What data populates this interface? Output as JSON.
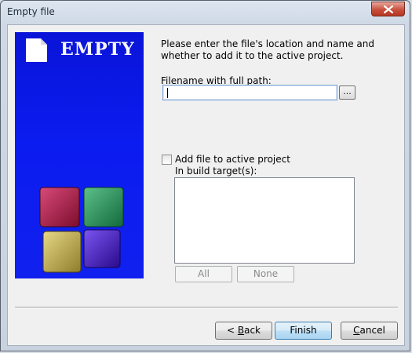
{
  "window": {
    "title": "Empty file",
    "close_icon": "close-x-icon"
  },
  "banner": {
    "text": "EMPTY",
    "icons": [
      "document-icon",
      "codeblocks-cubes-logo"
    ],
    "colors": {
      "background": "#0b1cf0",
      "cube_red": "#b0163e",
      "cube_green": "#1f8a52",
      "cube_yellow": "#c9b54a",
      "cube_purple": "#4a1bc0"
    }
  },
  "form": {
    "instruction_line1": "Please enter the file's location and name and",
    "instruction_line2": "whether to add it to the active project.",
    "filename_label": "Filename with full path:",
    "filename_value": "",
    "browse_label": "...",
    "add_to_project_label": "Add file to active project",
    "add_to_project_checked": false,
    "build_targets_label": "In build target(s):",
    "build_targets": [],
    "all_label": "All",
    "none_label": "None"
  },
  "buttons": {
    "back_prefix": "< ",
    "back_mnemonic": "B",
    "back_rest": "ack",
    "finish": "Finish",
    "cancel_mnemonic": "C",
    "cancel_rest": "ancel"
  }
}
